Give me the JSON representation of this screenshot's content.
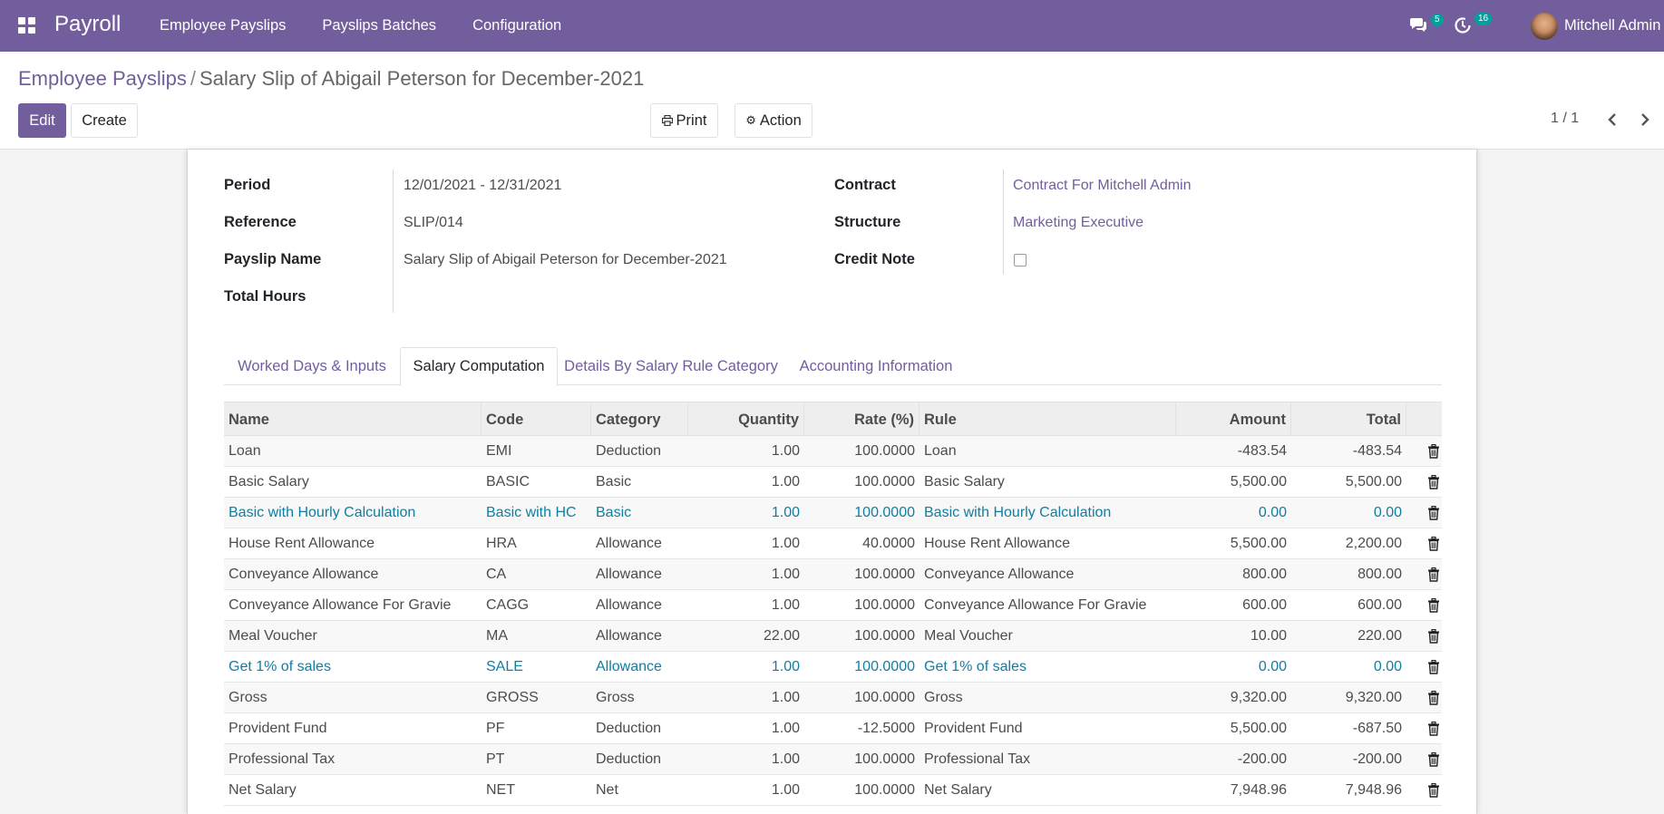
{
  "navbar": {
    "app_name": "Payroll",
    "menu": [
      "Employee Payslips",
      "Payslips Batches",
      "Configuration"
    ],
    "messages_count": "5",
    "activities_count": "16",
    "user_name": "Mitchell Admin"
  },
  "breadcrumb": {
    "parent": "Employee Payslips",
    "separator": "/",
    "current": "Salary Slip of Abigail Peterson for December-2021"
  },
  "buttons": {
    "edit": "Edit",
    "create": "Create",
    "print": "Print",
    "action": "Action"
  },
  "pager": {
    "value": "1 / 1"
  },
  "form": {
    "period_label": "Period",
    "period_value": "12/01/2021 - 12/31/2021",
    "reference_label": "Reference",
    "reference_value": "SLIP/014",
    "payslip_name_label": "Payslip Name",
    "payslip_name_value": "Salary Slip of Abigail Peterson for December-2021",
    "total_hours_label": "Total Hours",
    "contract_label": "Contract",
    "contract_value": "Contract For Mitchell Admin",
    "structure_label": "Structure",
    "structure_value": "Marketing Executive",
    "credit_note_label": "Credit Note",
    "credit_note_checked": false
  },
  "tabs": [
    {
      "label": "Worked Days & Inputs",
      "active": false
    },
    {
      "label": "Salary Computation",
      "active": true
    },
    {
      "label": "Details By Salary Rule Category",
      "active": false
    },
    {
      "label": "Accounting Information",
      "active": false
    }
  ],
  "table": {
    "columns": [
      "Name",
      "Code",
      "Category",
      "Quantity",
      "Rate (%)",
      "Rule",
      "Amount",
      "Total"
    ],
    "rows": [
      {
        "name": "Loan",
        "code": "EMI",
        "category": "Deduction",
        "quantity": "1.00",
        "rate": "100.0000",
        "rule": "Loan",
        "amount": "-483.54",
        "total": "-483.54",
        "info": false
      },
      {
        "name": "Basic Salary",
        "code": "BASIC",
        "category": "Basic",
        "quantity": "1.00",
        "rate": "100.0000",
        "rule": "Basic Salary",
        "amount": "5,500.00",
        "total": "5,500.00",
        "info": false
      },
      {
        "name": "Basic with Hourly Calculation",
        "code": "Basic with HC",
        "category": "Basic",
        "quantity": "1.00",
        "rate": "100.0000",
        "rule": "Basic with Hourly Calculation",
        "amount": "0.00",
        "total": "0.00",
        "info": true
      },
      {
        "name": "House Rent Allowance",
        "code": "HRA",
        "category": "Allowance",
        "quantity": "1.00",
        "rate": "40.0000",
        "rule": "House Rent Allowance",
        "amount": "5,500.00",
        "total": "2,200.00",
        "info": false
      },
      {
        "name": "Conveyance Allowance",
        "code": "CA",
        "category": "Allowance",
        "quantity": "1.00",
        "rate": "100.0000",
        "rule": "Conveyance Allowance",
        "amount": "800.00",
        "total": "800.00",
        "info": false
      },
      {
        "name": "Conveyance Allowance For Gravie",
        "code": "CAGG",
        "category": "Allowance",
        "quantity": "1.00",
        "rate": "100.0000",
        "rule": "Conveyance Allowance For Gravie",
        "amount": "600.00",
        "total": "600.00",
        "info": false
      },
      {
        "name": "Meal Voucher",
        "code": "MA",
        "category": "Allowance",
        "quantity": "22.00",
        "rate": "100.0000",
        "rule": "Meal Voucher",
        "amount": "10.00",
        "total": "220.00",
        "info": false
      },
      {
        "name": "Get 1% of sales",
        "code": "SALE",
        "category": "Allowance",
        "quantity": "1.00",
        "rate": "100.0000",
        "rule": "Get 1% of sales",
        "amount": "0.00",
        "total": "0.00",
        "info": true
      },
      {
        "name": "Gross",
        "code": "GROSS",
        "category": "Gross",
        "quantity": "1.00",
        "rate": "100.0000",
        "rule": "Gross",
        "amount": "9,320.00",
        "total": "9,320.00",
        "info": false
      },
      {
        "name": "Provident Fund",
        "code": "PF",
        "category": "Deduction",
        "quantity": "1.00",
        "rate": "-12.5000",
        "rule": "Provident Fund",
        "amount": "5,500.00",
        "total": "-687.50",
        "info": false
      },
      {
        "name": "Professional Tax",
        "code": "PT",
        "category": "Deduction",
        "quantity": "1.00",
        "rate": "100.0000",
        "rule": "Professional Tax",
        "amount": "-200.00",
        "total": "-200.00",
        "info": false
      },
      {
        "name": "Net Salary",
        "code": "NET",
        "category": "Net",
        "quantity": "1.00",
        "rate": "100.0000",
        "rule": "Net Salary",
        "amount": "7,948.96",
        "total": "7,948.96",
        "info": false
      }
    ]
  },
  "colors": {
    "brand": "#735e9d",
    "info_row": "#0e7ea3",
    "badge": "#00a09d"
  },
  "icons": [
    "apps-icon",
    "chat-icon",
    "activity-icon",
    "print-icon",
    "gear-icon",
    "chevron-left-icon",
    "chevron-right-icon",
    "trash-icon"
  ]
}
